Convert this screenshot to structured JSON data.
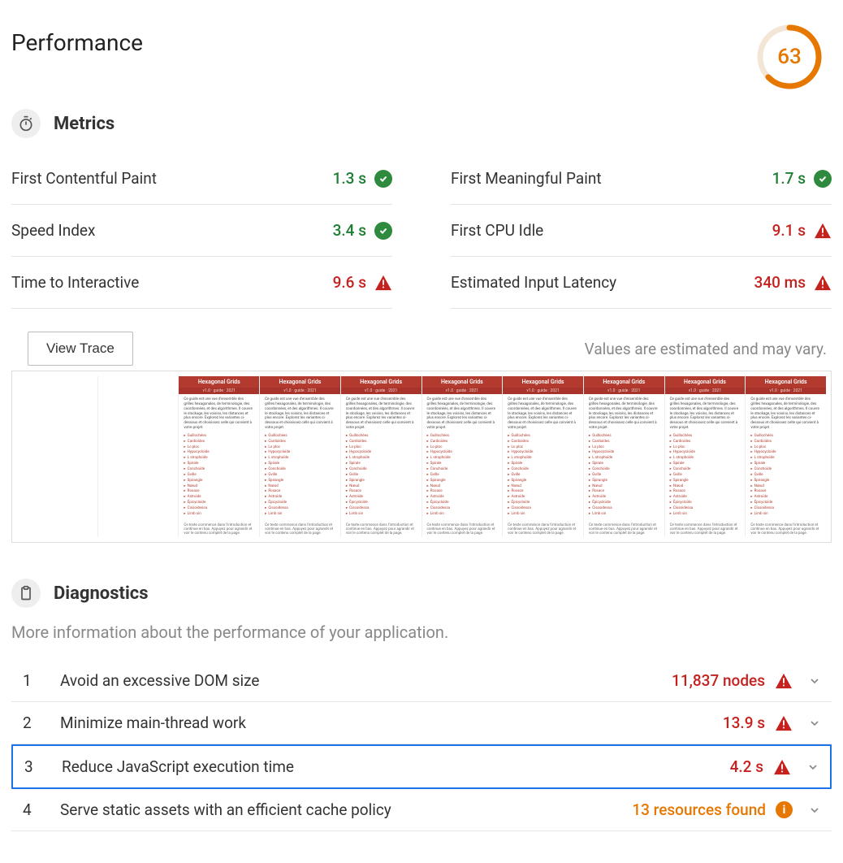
{
  "page_title": "Performance",
  "score": 63,
  "colors": {
    "pass": "#2e8b3d",
    "fail": "#c5221f",
    "warn": "#e67700"
  },
  "metrics_section": {
    "title": "Metrics",
    "items": [
      {
        "label": "First Contentful Paint",
        "value": "1.3 s",
        "status": "pass"
      },
      {
        "label": "First Meaningful Paint",
        "value": "1.7 s",
        "status": "pass"
      },
      {
        "label": "Speed Index",
        "value": "3.4 s",
        "status": "pass"
      },
      {
        "label": "First CPU Idle",
        "value": "9.1 s",
        "status": "fail"
      },
      {
        "label": "Time to Interactive",
        "value": "9.6 s",
        "status": "fail"
      },
      {
        "label": "Estimated Input Latency",
        "value": "340 ms",
        "status": "fail"
      }
    ]
  },
  "view_trace_label": "View Trace",
  "estimation_note": "Values are estimated and may vary.",
  "filmstrip": {
    "frame_title": "Hexagonal Grids",
    "frames_blank": 2,
    "frames_content": 8
  },
  "diagnostics_section": {
    "title": "Diagnostics",
    "description": "More information about the performance of your application.",
    "items": [
      {
        "num": "1",
        "label": "Avoid an excessive DOM size",
        "value": "11,837 nodes",
        "status": "fail",
        "selected": false
      },
      {
        "num": "2",
        "label": "Minimize main-thread work",
        "value": "13.9 s",
        "status": "fail",
        "selected": false
      },
      {
        "num": "3",
        "label": "Reduce JavaScript execution time",
        "value": "4.2 s",
        "status": "fail",
        "selected": true
      },
      {
        "num": "4",
        "label": "Serve static assets with an efficient cache policy",
        "value": "13 resources found",
        "status": "warn",
        "selected": false
      }
    ]
  }
}
